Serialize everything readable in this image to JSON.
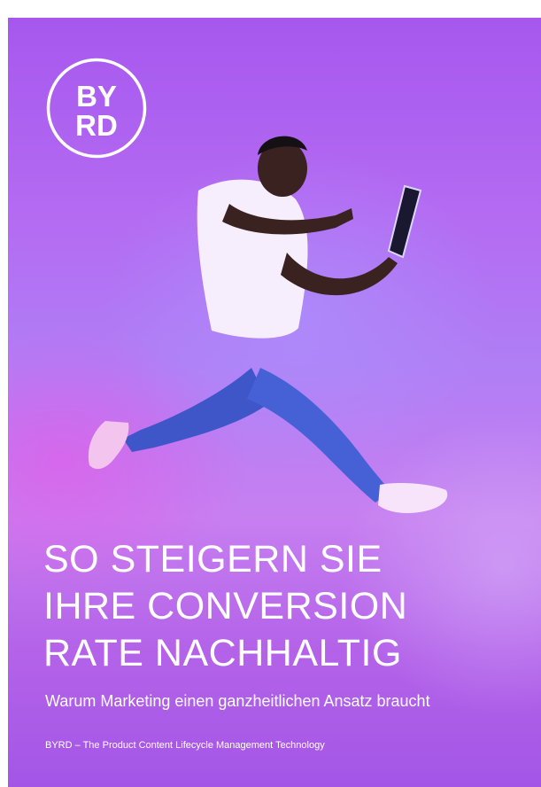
{
  "brand": {
    "logo_line1": "BY",
    "logo_line2": "RD"
  },
  "cover": {
    "headline_lines": [
      "SO STEIGERN SIE",
      "IHRE CONVERSION",
      "RATE NACHHALTIG"
    ],
    "subtitle": "Warum Marketing einen ganzheitlichen Ansatz braucht",
    "footer": "BYRD – The Product Content Lifecycle Management Technology"
  },
  "colors": {
    "background_top": "#a658ee",
    "background_glow_left": "#e954e6",
    "background_glow_right": "#d6b4fa",
    "text": "#ffffff"
  },
  "hero_image": "photo-man-jumping-with-tablet"
}
